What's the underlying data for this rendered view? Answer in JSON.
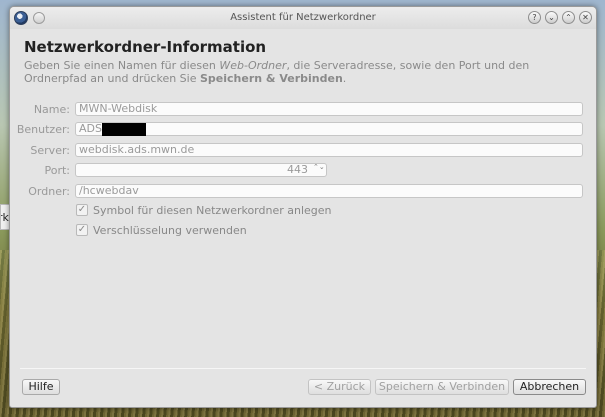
{
  "window": {
    "title": "Assistent für Netzwerkordner"
  },
  "page": {
    "heading": "Netzwerkordner-Information",
    "description_part1": "Geben Sie einen Namen für diesen ",
    "description_em": "Web-Ordner",
    "description_part2": ", die Serveradresse, sowie den Port und den Ordnerpfad an und drücken Sie ",
    "description_strong": "Speichern & Verbinden",
    "description_part3": "."
  },
  "form": {
    "name_label": "Name:",
    "name_value": "MWN-Webdisk",
    "user_label": "Benutzer:",
    "user_value": "ADSW",
    "server_label": "Server:",
    "server_value": "webdisk.ads.mwn.de",
    "port_label": "Port:",
    "port_value": "443",
    "folder_label": "Ordner:",
    "folder_value": "/hcwebdav"
  },
  "options": {
    "symbol_label": "Symbol für diesen Netzwerkordner anlegen",
    "symbol_checked": true,
    "encryption_label": "Verschlüsselung verwenden",
    "encryption_checked": true
  },
  "buttons": {
    "help": "Hilfe",
    "back": "< Zurück",
    "save_connect": "Speichern & Verbinden",
    "cancel": "Abbrechen"
  },
  "background": {
    "window_text": "rk"
  },
  "icons": {
    "check": "✓",
    "spin": "⌃⌄",
    "help": "?",
    "minimize": "⌄",
    "maximize": "⌃",
    "close": "✕"
  }
}
